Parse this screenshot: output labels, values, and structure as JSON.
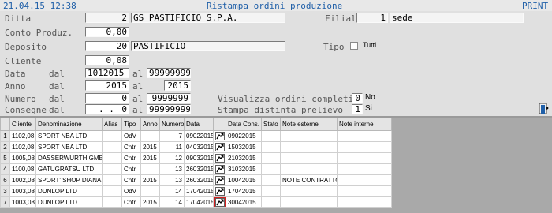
{
  "header": {
    "datetime": "21.04.15 12:38",
    "title": "Ristampa ordini produzione",
    "print_label": "PRINT"
  },
  "form": {
    "ditta": {
      "label": "Ditta",
      "code": "2",
      "name": "GS PASTIFICIO S.P.A."
    },
    "filiale": {
      "label": "Filiale",
      "code": "1",
      "name": "sede"
    },
    "conto_produz": {
      "label": "Conto Produz.",
      "value": "0,00"
    },
    "deposito": {
      "label": "Deposito",
      "code": "20",
      "name": "PASTIFICIO"
    },
    "tipo": {
      "label": "Tipo",
      "value": "Tutti"
    },
    "cliente": {
      "label": "Cliente",
      "value": "0,08"
    },
    "data": {
      "label": "Data",
      "dal_label": "dal",
      "from": "1012015",
      "al_label": "al",
      "to": "99999999"
    },
    "anno": {
      "label": "Anno",
      "dal_label": "dal",
      "from": "2015",
      "al_label": "al",
      "to": "2015"
    },
    "numero": {
      "label": "Numero",
      "dal_label": "dal",
      "from": "0",
      "al_label": "al",
      "to": "9999999"
    },
    "consegne": {
      "label": "Consegne",
      "dal_label": "dal",
      "from": ". .",
      "from_val": "0",
      "al_label": "al",
      "to": "99999999"
    },
    "visualizza": {
      "label": "Visualizza ordini completi",
      "value": "0",
      "text": "No"
    },
    "stampa": {
      "label": "Stampa distinta prelievo",
      "value": "1",
      "text": "Si"
    }
  },
  "grid": {
    "columns": [
      "",
      "Cliente",
      "Denominazione",
      "Alias",
      "Tipo",
      "Anno",
      "Numero",
      "Data",
      "",
      "Data Cons.",
      "Stato",
      "Note esterne",
      "Note interne"
    ],
    "rows": [
      {
        "n": "1",
        "cliente": "1102,08",
        "denom": "SPORT NBA LTD",
        "alias": "",
        "tipo": "OdV",
        "anno": "",
        "numero": "7",
        "data": "09022015",
        "cons": "09022015",
        "stato": "",
        "note_est": "",
        "note_int": ""
      },
      {
        "n": "2",
        "cliente": "1102,08",
        "denom": "SPORT NBA LTD",
        "alias": "",
        "tipo": "Cntr",
        "anno": "2015",
        "numero": "11",
        "data": "04032015",
        "cons": "15032015",
        "stato": "",
        "note_est": "",
        "note_int": ""
      },
      {
        "n": "5",
        "cliente": "1005,08",
        "denom": "DASSERWURTH GMBH",
        "alias": "",
        "tipo": "Cntr",
        "anno": "2015",
        "numero": "12",
        "data": "09032015",
        "cons": "21032015",
        "stato": "",
        "note_est": "",
        "note_int": ""
      },
      {
        "n": "4",
        "cliente": "1100,08",
        "denom": "GATUGRATSU LTD",
        "alias": "",
        "tipo": "Cntr",
        "anno": "",
        "numero": "13",
        "data": "26032015",
        "cons": "31032015",
        "stato": "",
        "note_est": "",
        "note_int": ""
      },
      {
        "n": "6",
        "cliente": "1002,08",
        "denom": "SPORT' SHOP DIANA",
        "alias": "",
        "tipo": "Cntr",
        "anno": "2015",
        "numero": "13",
        "data": "26032015",
        "cons": "10042015",
        "stato": "",
        "note_est": "NOTE CONTRATTO",
        "note_int": ""
      },
      {
        "n": "3",
        "cliente": "1003,08",
        "denom": "DUNLOP LTD",
        "alias": "",
        "tipo": "OdV",
        "anno": "",
        "numero": "14",
        "data": "17042015",
        "cons": "17042015",
        "stato": "",
        "note_est": "",
        "note_int": ""
      },
      {
        "n": "7",
        "cliente": "1003,08",
        "denom": "DUNLOP LTD",
        "alias": "",
        "tipo": "Cntr",
        "anno": "2015",
        "numero": "14",
        "data": "17042015",
        "cons": "30042015",
        "stato": "",
        "note_est": "",
        "note_int": ""
      }
    ],
    "selected_row": 6
  },
  "colors": {
    "header_text": "#1f5fa8",
    "grid_bg": "#a9a9a9",
    "selected_outline": "#d42020"
  },
  "icons": {
    "row_action": "print-order-icon",
    "exit": "exit-door-icon"
  }
}
